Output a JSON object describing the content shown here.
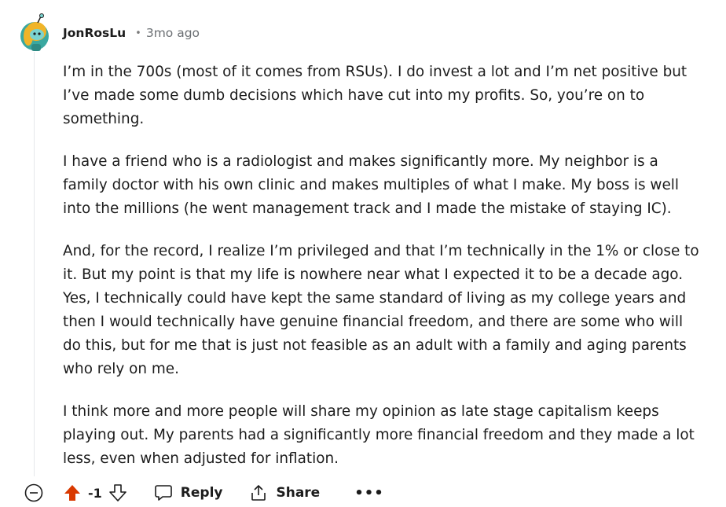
{
  "comment": {
    "author": "JonRosLu",
    "separator": "•",
    "age": "3mo ago",
    "paragraphs": [
      "I’m in the 700s (most of it comes from RSUs). I do invest a lot and I’m net positive but\nI’ve made some dumb decisions which have cut into my profits. So, you’re on to\nsomething.",
      "I have a friend who is a radiologist and makes significantly more. My neighbor is a\nfamily doctor with his own clinic and makes multiples of what I make. My boss is well\ninto the millions (he went management track and I made the mistake of staying IC).",
      "And, for the record, I realize I’m privileged and that I’m technically in the 1% or close to\nit. But my point is that my life is nowhere near what I expected it to be a decade ago.\nYes, I technically could have kept the same standard of living as my college years and\nthen I would technically have genuine financial freedom, and there are some who will\ndo this, but for me that is just not feasible as an adult with a family and aging parents\nwho rely on me.",
      "I think more and more people will share my opinion as late stage capitalism keeps\nplaying out. My parents had a significantly more financial freedom and they made a lot\nless, even when adjusted for inflation."
    ]
  },
  "actions": {
    "vote_count": "-1",
    "reply_label": "Reply",
    "share_label": "Share",
    "more_label": "•••"
  },
  "colors": {
    "upvote_active": "#d93900",
    "text": "#1c1c1c",
    "meta": "#6a6e72"
  },
  "icons": {
    "collapse": "minus-circle-icon",
    "upvote": "arrow-up-icon",
    "downvote": "arrow-down-icon",
    "reply": "speech-bubble-icon",
    "share": "share-icon",
    "more": "ellipsis-icon"
  }
}
